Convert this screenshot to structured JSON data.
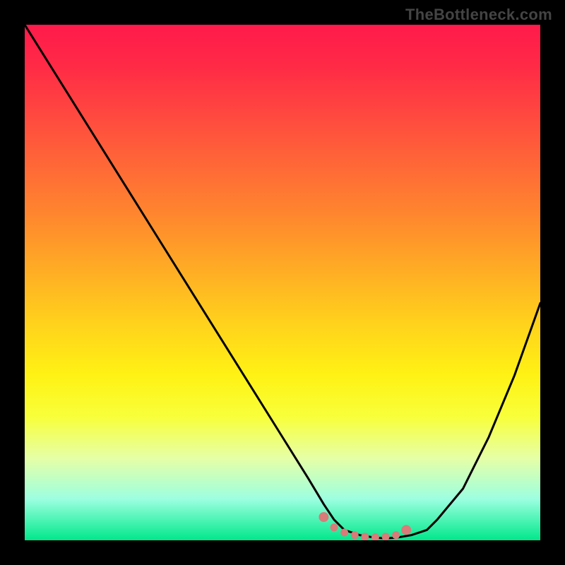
{
  "attribution": "TheBottleneck.com",
  "colors": {
    "frame": "#000000",
    "gradient_top": "#ff1a4b",
    "gradient_bottom": "#00e88b",
    "curve": "#000000",
    "marker": "#d87b79"
  },
  "chart_data": {
    "type": "line",
    "title": "",
    "xlabel": "",
    "ylabel": "",
    "xlim": [
      0,
      100
    ],
    "ylim": [
      0,
      100
    ],
    "grid": false,
    "legend": false,
    "series": [
      {
        "name": "bottleneck_curve",
        "x": [
          0,
          5,
          10,
          15,
          20,
          25,
          30,
          35,
          40,
          45,
          50,
          55,
          58,
          60,
          62,
          65,
          68,
          70,
          72,
          75,
          78,
          80,
          85,
          90,
          95,
          100
        ],
        "y": [
          100,
          92,
          84,
          76,
          68,
          60,
          52,
          44,
          36,
          28,
          20,
          12,
          7,
          4,
          2,
          1,
          0.5,
          0.4,
          0.5,
          1,
          2,
          4,
          10,
          20,
          32,
          46
        ]
      }
    ],
    "markers": {
      "name": "optimal_band",
      "x": [
        58,
        60,
        62,
        64,
        66,
        68,
        70,
        72,
        74
      ],
      "y": [
        4.5,
        2.5,
        1.5,
        1.0,
        0.7,
        0.6,
        0.7,
        1.0,
        2.0
      ]
    }
  }
}
